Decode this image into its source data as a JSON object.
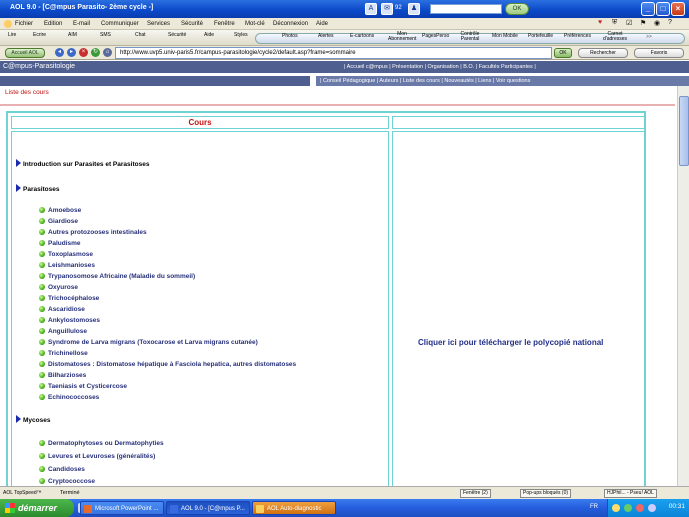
{
  "window": {
    "title": "AOL 9.0 - [C@mpus Parasito- 2ème cycle -]",
    "mail_count": "92",
    "ok_label": "OK"
  },
  "menu": [
    "Fichier",
    "Edition",
    "E-mail",
    "Communiquer",
    "Services",
    "Sécurité",
    "Fenêtre",
    "Mot-clé",
    "Déconnexion",
    "Aide"
  ],
  "toolbar": {
    "items": [
      "Lire",
      "Ecrire",
      "AIM",
      "SMS",
      "Chat",
      "Sécurité",
      "Aide",
      "Styles"
    ],
    "pill_items": [
      "Photos",
      "Alertes",
      "E-cartoons",
      "Mon Abonnement",
      "PagesPerso",
      "Contrôle Parental",
      "Mon Mobile",
      "Portefeuille",
      "Préférences",
      "Carnet d'adresses"
    ]
  },
  "address_bar": {
    "aol_button": "Accueil AOL",
    "url": "http://www.uvp5.univ-paris5.fr/campus-parasitologie/cycle2/default.asp?frame=sommaire",
    "go_label": "OK",
    "search_label": "Rechercher",
    "favorites_label": "Favoris"
  },
  "site": {
    "brand": "C@mpus-Parasitologie",
    "top_links": "| Accueil c@mpus | Présentation | Organisation | B.O. | Facultés Participantes |",
    "nav_links": "| Conseil Pédagogique | Auteurs | Liste des cours | Nouveautés | Liens | Voir questions",
    "section_title": "Liste des cours"
  },
  "courses": {
    "header": "Cours",
    "intro": "Introduction sur Parasites et Parasitoses",
    "sections": [
      {
        "title": "Parasitoses",
        "items": [
          "Amoebose",
          "Giardiose",
          "Autres protozooses intestinales",
          "Paludisme",
          "Toxoplasmose",
          "Leishmanioses",
          "Trypanosomose Africaine (Maladie du sommeil)",
          "Oxyurose",
          "Trichocéphalose",
          "Ascaridiose",
          "Ankylostomoses",
          "Anguillulose",
          "Syndrome de Larva migrans (Toxocarose et Larva migrans cutanée)",
          "Trichinellose",
          "Distomatoses : Distomatose hépatique à Fasciola hepatica, autres distomatoses",
          "Bilharzioses",
          "Taeniasis et Cysticercose",
          "Echinococcoses"
        ]
      },
      {
        "title": "Mycoses",
        "items": [
          "Dermatophytoses ou Dermatophyties",
          "Levures et Levuroses (généralités)",
          "Candidoses",
          "Cryptococcose"
        ]
      }
    ],
    "download_link": "Cliquer ici pour télécharger le polycopié national"
  },
  "status": {
    "left_label": "AOL TopSpeed™",
    "text": "Terminé",
    "windows": "Fenêtre (2)",
    "popups": "Pop-ups bloqués (0)",
    "user": "HJPhil... - Pseu! AOL"
  },
  "taskbar": {
    "start": "démarrer",
    "tasks": [
      "Microsoft PowerPoint ...",
      "AOL 9.0 - [C@mpus P...",
      "AOL Auto-diagnostic"
    ],
    "clock": "00:31"
  }
}
